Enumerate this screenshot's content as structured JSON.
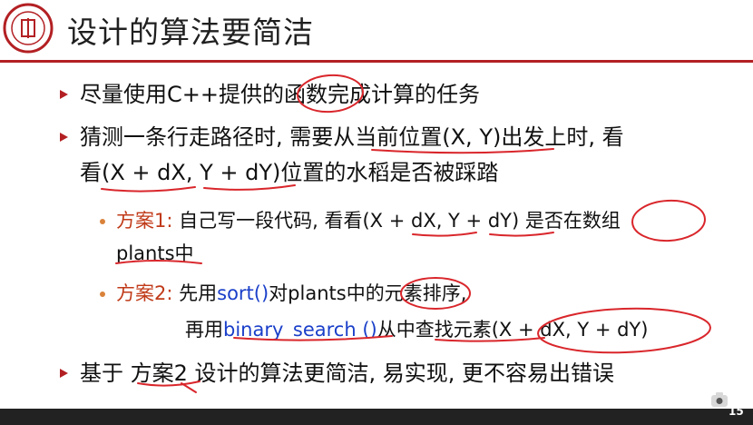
{
  "slide": {
    "title": "设计的算法要简洁",
    "page_number": "15",
    "colors": {
      "accent": "#b32023",
      "red_text": "#c03a18",
      "blue_text": "#1a3fc9",
      "ink": "#d9262b"
    },
    "bullets": [
      {
        "text": "尽量使用C++提供的函数完成计算的任务"
      },
      {
        "line1": "猜测一条行走路径时, 需要从当前位置(X, Y)出发上时, 看",
        "line2": "看(X + dX, Y + dY)位置的水稻是否被踩踏"
      },
      {
        "text": "基于 方案2 设计的算法更简洁, 易实现, 更不容易出错误"
      }
    ],
    "sub_bullets": [
      {
        "label": "方案1:",
        "line1": " 自己写一段代码, 看看(X + dX, Y + dY) 是否在数组",
        "line2": "plants中"
      },
      {
        "label": "方案2:",
        "line1_pre": " 先用",
        "line1_func": "sort()",
        "line1_post": "对plants中的元素排序,",
        "line2_pre": "再用",
        "line2_func": "binary_search ()",
        "line2_post": "从中查找元素(X + dX, Y + dY)"
      }
    ]
  }
}
